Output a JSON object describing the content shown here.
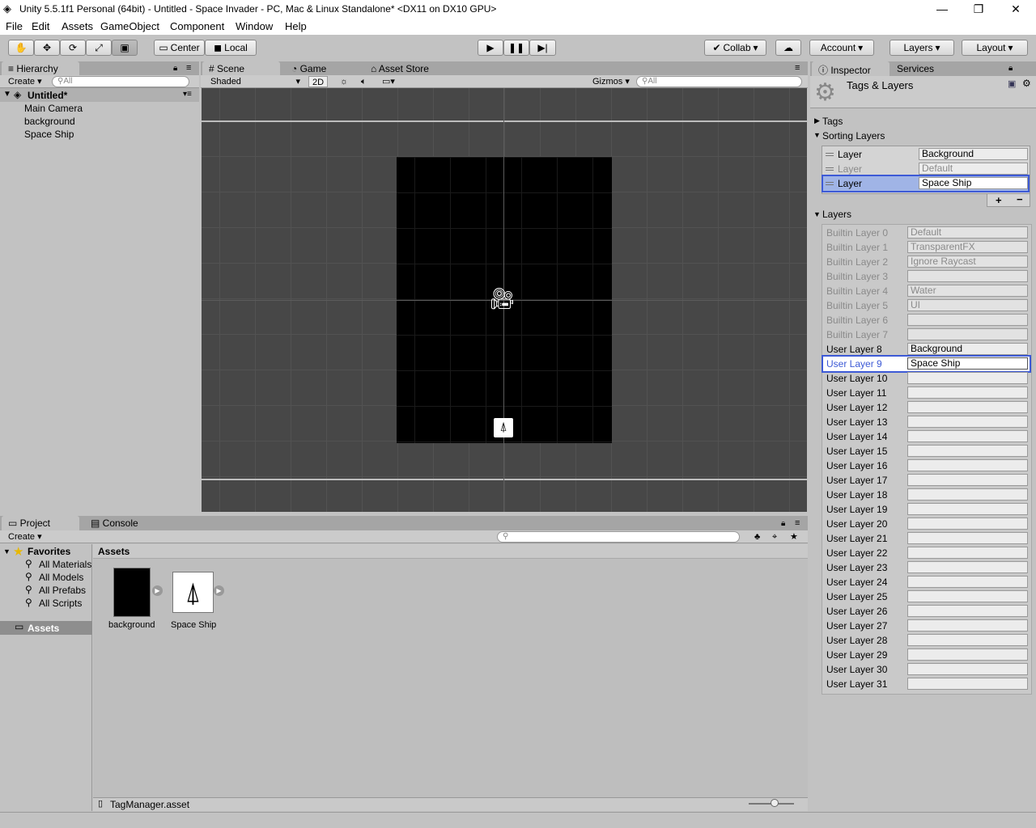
{
  "window": {
    "title": "Unity 5.5.1f1 Personal (64bit) - Untitled - Space Invader - PC, Mac & Linux Standalone* <DX11 on DX10 GPU>"
  },
  "menu": [
    "File",
    "Edit",
    "Assets",
    "GameObject",
    "Component",
    "Window",
    "Help"
  ],
  "toolbar": {
    "pivot_label": "Center",
    "space_label": "Local",
    "collab_label": "Collab",
    "account_label": "Account",
    "layers_label": "Layers",
    "layout_label": "Layout"
  },
  "hierarchy": {
    "tab": "Hierarchy",
    "create": "Create",
    "search": "All",
    "scene": "Untitled*",
    "items": [
      "Main Camera",
      "background",
      "Space Ship"
    ]
  },
  "scene": {
    "tabs": [
      "Scene",
      "Game",
      "Asset Store"
    ],
    "shading": "Shaded",
    "mode_2d": "2D",
    "gizmos": "Gizmos",
    "search": "All"
  },
  "project": {
    "tabs": [
      "Project",
      "Console"
    ],
    "create": "Create",
    "favorites_label": "Favorites",
    "favorites": [
      "All Materials",
      "All Models",
      "All Prefabs",
      "All Scripts"
    ],
    "assets_folder": "Assets",
    "breadcrumb": "Assets",
    "assets": [
      "background",
      "Space Ship"
    ],
    "selected_file": "TagManager.asset"
  },
  "inspector": {
    "tabs": [
      "Inspector",
      "Services"
    ],
    "title": "Tags & Layers",
    "tags_label": "Tags",
    "sorting_label": "Sorting Layers",
    "sorting_layers": [
      {
        "label": "Layer",
        "value": "Background"
      },
      {
        "label": "Layer",
        "value": "Default"
      },
      {
        "label": "Layer",
        "value": "Space Ship"
      }
    ],
    "add": "+",
    "remove": "−",
    "layers_label": "Layers",
    "layers": [
      {
        "label": "Builtin Layer 0",
        "value": "Default"
      },
      {
        "label": "Builtin Layer 1",
        "value": "TransparentFX"
      },
      {
        "label": "Builtin Layer 2",
        "value": "Ignore Raycast"
      },
      {
        "label": "Builtin Layer 3",
        "value": ""
      },
      {
        "label": "Builtin Layer 4",
        "value": "Water"
      },
      {
        "label": "Builtin Layer 5",
        "value": "UI"
      },
      {
        "label": "Builtin Layer 6",
        "value": ""
      },
      {
        "label": "Builtin Layer 7",
        "value": ""
      },
      {
        "label": "User Layer 8",
        "value": "Background"
      },
      {
        "label": "User Layer 9",
        "value": "Space Ship"
      },
      {
        "label": "User Layer 10",
        "value": ""
      },
      {
        "label": "User Layer 11",
        "value": ""
      },
      {
        "label": "User Layer 12",
        "value": ""
      },
      {
        "label": "User Layer 13",
        "value": ""
      },
      {
        "label": "User Layer 14",
        "value": ""
      },
      {
        "label": "User Layer 15",
        "value": ""
      },
      {
        "label": "User Layer 16",
        "value": ""
      },
      {
        "label": "User Layer 17",
        "value": ""
      },
      {
        "label": "User Layer 18",
        "value": ""
      },
      {
        "label": "User Layer 19",
        "value": ""
      },
      {
        "label": "User Layer 20",
        "value": ""
      },
      {
        "label": "User Layer 21",
        "value": ""
      },
      {
        "label": "User Layer 22",
        "value": ""
      },
      {
        "label": "User Layer 23",
        "value": ""
      },
      {
        "label": "User Layer 24",
        "value": ""
      },
      {
        "label": "User Layer 25",
        "value": ""
      },
      {
        "label": "User Layer 26",
        "value": ""
      },
      {
        "label": "User Layer 27",
        "value": ""
      },
      {
        "label": "User Layer 28",
        "value": ""
      },
      {
        "label": "User Layer 29",
        "value": ""
      },
      {
        "label": "User Layer 30",
        "value": ""
      },
      {
        "label": "User Layer 31",
        "value": ""
      }
    ]
  },
  "colors": {
    "selection": "#3d5ad6",
    "panel": "#c2c2c2",
    "scene_bg": "#474747"
  }
}
